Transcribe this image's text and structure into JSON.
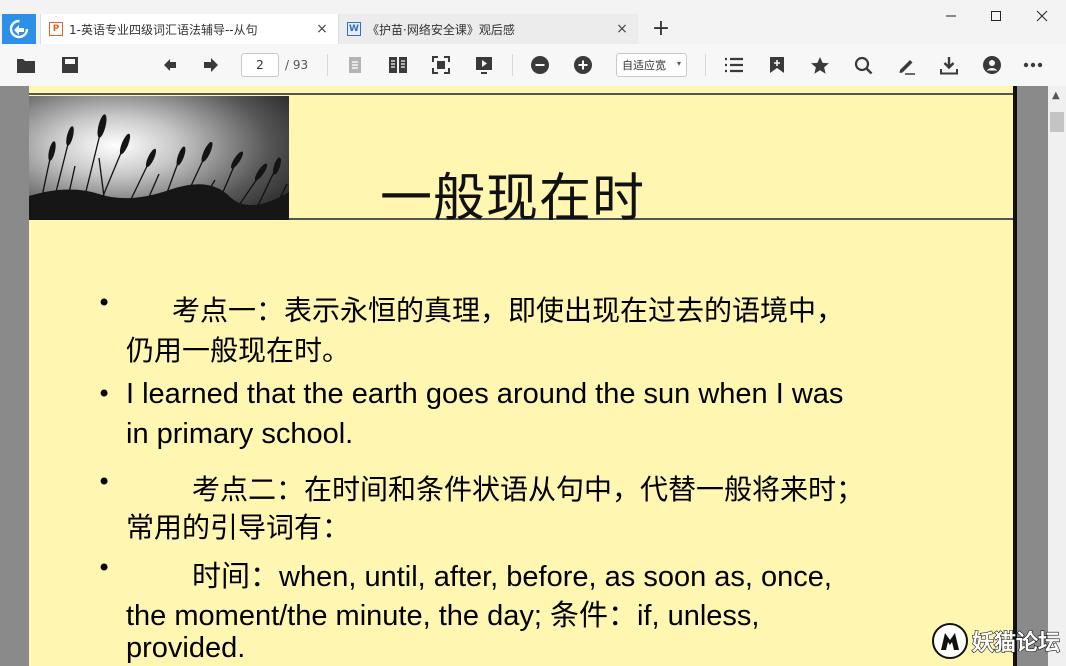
{
  "tabs": [
    {
      "title": "1-英语专业四级词汇语法辅导--从句",
      "file_type": "ppt",
      "file_icon": "P",
      "close": "×"
    },
    {
      "title": "《护苗·网络安全课》观后感",
      "file_type": "word",
      "file_icon": "W",
      "close": "×"
    }
  ],
  "new_tab": "+",
  "window_controls": {
    "minimize": "—",
    "maximize": "☐",
    "close": "✕"
  },
  "toolbar": {
    "current_page": "2",
    "total_pages": "/ 93",
    "zoom_mode": "自适应宽",
    "zoom_caret": "▾"
  },
  "slide": {
    "title": "一般现在时",
    "lines": [
      {
        "text": "考点一：表示永恒的真理，即使出现在过去的语境中，"
      },
      {
        "text": "仍用一般现在时。"
      },
      {
        "text": "I learned that the earth goes around the sun when I was"
      },
      {
        "text": "in primary school."
      },
      {
        "text": "考点二：在时间和条件状语从句中，代替一般将来时；"
      },
      {
        "text": "常用的引导词有："
      },
      {
        "text": "时间：when, until, after, before, as soon as, once,"
      },
      {
        "text": "the moment/the minute, the day; 条件：if, unless,"
      },
      {
        "text": "provided."
      }
    ],
    "bullet": "•"
  },
  "scrollbar_up": "▲",
  "watermark": {
    "text": "妖猫论坛"
  },
  "colors": {
    "accent": "#2d8fe6",
    "page_bg": "#fff6b2",
    "viewer_bg": "#8a8a8a",
    "ppt": "#e0651f",
    "word": "#2b73c6"
  }
}
